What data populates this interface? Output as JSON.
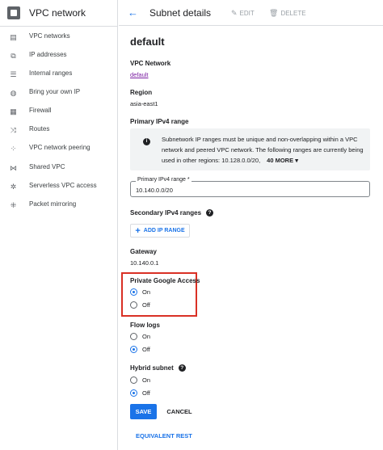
{
  "sidebar": {
    "title": "VPC network",
    "items": [
      {
        "label": "VPC networks",
        "icon": "vpc-networks-icon"
      },
      {
        "label": "IP addresses",
        "icon": "ip-addresses-icon"
      },
      {
        "label": "Internal ranges",
        "icon": "internal-ranges-icon"
      },
      {
        "label": "Bring your own IP",
        "icon": "globe-icon"
      },
      {
        "label": "Firewall",
        "icon": "firewall-icon"
      },
      {
        "label": "Routes",
        "icon": "routes-icon"
      },
      {
        "label": "VPC network peering",
        "icon": "peering-icon"
      },
      {
        "label": "Shared VPC",
        "icon": "shared-vpc-icon"
      },
      {
        "label": "Serverless VPC access",
        "icon": "serverless-icon"
      },
      {
        "label": "Packet mirroring",
        "icon": "packet-mirroring-icon"
      }
    ]
  },
  "header": {
    "title": "Subnet details",
    "edit_label": "EDIT",
    "delete_label": "DELETE"
  },
  "subnet": {
    "name": "default",
    "vpc_network_label": "VPC Network",
    "vpc_network_value": "default",
    "region_label": "Region",
    "region_value": "asia-east1",
    "primary_range_label": "Primary IPv4 range",
    "info_text": "Subnetwork IP ranges must be unique and non-overlapping within a VPC network and peered VPC network. The following ranges are currently being used in other regions: 10.128.0.0/20,",
    "info_more": "40 MORE",
    "primary_field_label": "Primary IPv4 range *",
    "primary_field_value": "10.140.0.0/20",
    "secondary_label": "Secondary IPv4 ranges",
    "add_ip_range_label": "ADD IP RANGE",
    "gateway_label": "Gateway",
    "gateway_value": "10.140.0.1",
    "private_access": {
      "label": "Private Google Access",
      "on": "On",
      "off": "Off",
      "selected": "On"
    },
    "flow_logs": {
      "label": "Flow logs",
      "on": "On",
      "off": "Off",
      "selected": "Off"
    },
    "hybrid_subnet": {
      "label": "Hybrid subnet",
      "on": "On",
      "off": "Off",
      "selected": "Off"
    }
  },
  "actions": {
    "save": "SAVE",
    "cancel": "CANCEL",
    "equivalent_rest": "EQUIVALENT REST"
  },
  "colors": {
    "accent": "#1a73e8",
    "highlight_border": "#d93025",
    "link_visited": "#7b1fa2"
  }
}
